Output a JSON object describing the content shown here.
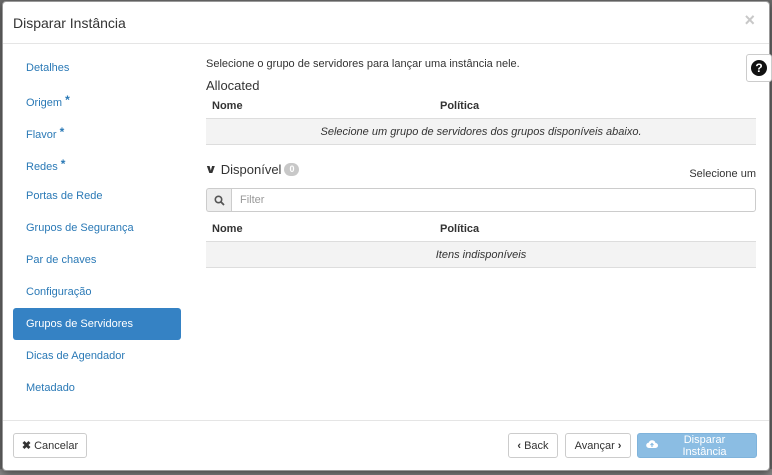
{
  "dialog": {
    "title": "Disparar Instância",
    "close_glyph": "×"
  },
  "nav": {
    "items": [
      {
        "label": "Detalhes",
        "required": false,
        "active": false
      },
      {
        "label": "Origem",
        "required": true,
        "active": false
      },
      {
        "label": "Flavor",
        "required": true,
        "active": false
      },
      {
        "label": "Redes",
        "required": true,
        "active": false
      },
      {
        "label": "Portas de Rede",
        "required": false,
        "active": false
      },
      {
        "label": "Grupos de Segurança",
        "required": false,
        "active": false
      },
      {
        "label": "Par de chaves",
        "required": false,
        "active": false
      },
      {
        "label": "Configuração",
        "required": false,
        "active": false
      },
      {
        "label": "Grupos de Servidores",
        "required": false,
        "active": true
      },
      {
        "label": "Dicas de Agendador",
        "required": false,
        "active": false
      },
      {
        "label": "Metadado",
        "required": false,
        "active": false
      }
    ],
    "required_marker": "*"
  },
  "content": {
    "help_text": "Selecione o grupo de servidores para lançar uma instância nele.",
    "help_icon": "?",
    "allocated": {
      "title": "Allocated",
      "columns": [
        "Nome",
        "Política"
      ],
      "empty_message": "Selecione um grupo de servidores dos grupos disponíveis abaixo."
    },
    "available": {
      "title": "Disponível",
      "count": "0",
      "select_one": "Selecione um",
      "filter_placeholder": "Filter",
      "columns": [
        "Nome",
        "Política"
      ],
      "empty_message": "Itens indisponíveis"
    }
  },
  "footer": {
    "cancel_label": "Cancelar",
    "back_label": "Back",
    "next_label": "Avançar",
    "launch_label": "Disparar Instância"
  },
  "colors": {
    "accent": "#3582c4",
    "link": "#2a79b6",
    "launch_disabled": "#8bbde3"
  }
}
